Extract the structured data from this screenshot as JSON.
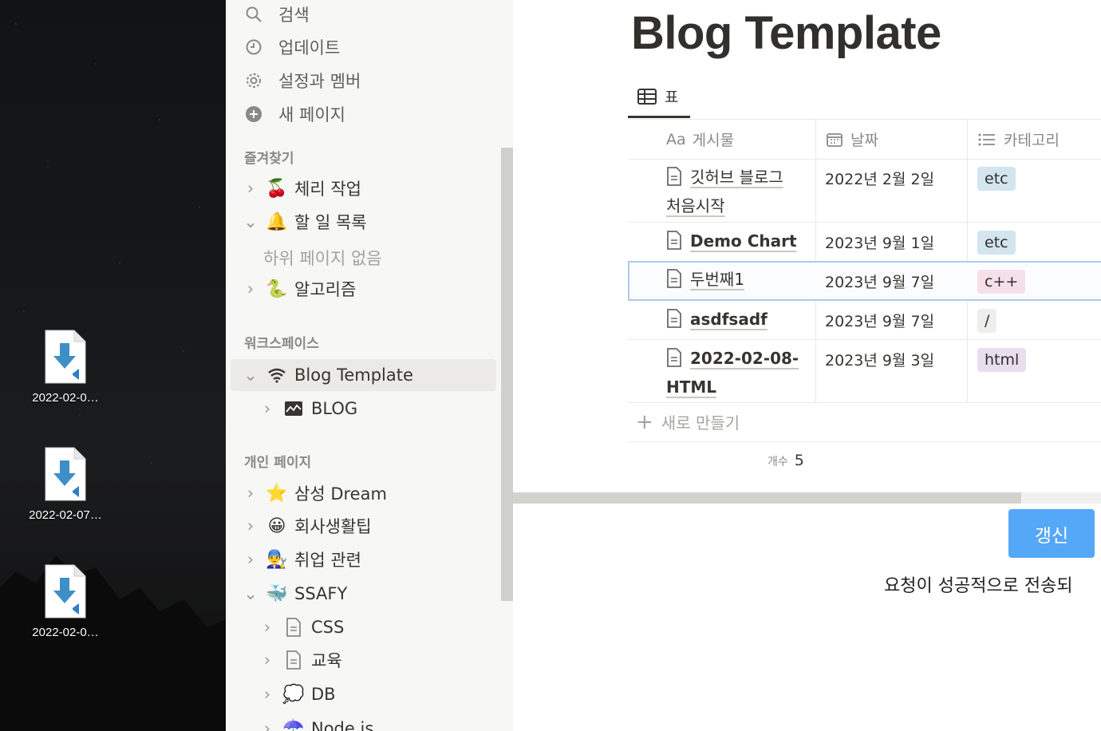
{
  "desktop": {
    "icons": [
      {
        "label": "2022-02-0…"
      },
      {
        "label": "2022-02-07…"
      },
      {
        "label": "2022-02-0…"
      }
    ]
  },
  "sidebar": {
    "nav": [
      {
        "label": "검색",
        "icon": "search-icon"
      },
      {
        "label": "업데이트",
        "icon": "clock-icon"
      },
      {
        "label": "설정과 멤버",
        "icon": "gear-icon"
      },
      {
        "label": "새 페이지",
        "icon": "plus-circle-icon"
      }
    ],
    "favorites_label": "즐겨찾기",
    "favorites": [
      {
        "label": "체리 작업",
        "emoji": "🍒"
      },
      {
        "label": "할 일 목록",
        "emoji": "🔔"
      },
      {
        "label": "알고리즘",
        "emoji": "🐍"
      }
    ],
    "no_subpages": "하위 페이지 없음",
    "workspace_label": "워크스페이스",
    "workspace": [
      {
        "label": "Blog Template"
      },
      {
        "label": "BLOG"
      }
    ],
    "personal_label": "개인 페이지",
    "personal": [
      {
        "label": "삼성 Dream",
        "emoji": "⭐"
      },
      {
        "label": "회사생활팁",
        "emoji": "😀"
      },
      {
        "label": "취업 관련",
        "emoji": "👨‍🔧"
      },
      {
        "label": "SSAFY",
        "emoji": "🐳"
      },
      {
        "label": "CSS"
      },
      {
        "label": "교육"
      },
      {
        "label": "DB",
        "emoji": "💭"
      },
      {
        "label": "Node.js",
        "emoji": "☂️"
      }
    ]
  },
  "main": {
    "title": "Blog Template",
    "view_tab": "표",
    "columns": [
      {
        "prefix": "Aa",
        "label": "게시물"
      },
      {
        "label": "날짜",
        "icon": "calendar-icon"
      },
      {
        "label": "카테고리",
        "icon": "list-icon"
      }
    ],
    "rows": [
      {
        "title_line1": "깃허브 블로그",
        "title_line2": "처음시작",
        "date": "2022년 2월 2일",
        "tag": "etc",
        "tag_color": "#d3e5ef"
      },
      {
        "title_line1": "Demo Chart",
        "title_line2": "",
        "date": "2023년 9월 1일",
        "tag": "etc",
        "tag_color": "#d3e5ef"
      },
      {
        "title_line1": "두번째1",
        "title_line2": "",
        "date": "2023년 9월 7일",
        "tag": "c++",
        "tag_color": "#f5e0e9"
      },
      {
        "title_line1": "asdfsadf",
        "title_line2": "",
        "date": "2023년 9월 7일",
        "tag": "/",
        "tag_color": "#eeeeed"
      },
      {
        "title_line1": "2022-02-08-",
        "title_line2": "HTML",
        "date": "2023년 9월 3일",
        "tag": "html",
        "tag_color": "#e8deee"
      }
    ],
    "new_row": "새로 만들기",
    "count_label": "개수",
    "count_value": "5",
    "update_button": "갱신",
    "status_message": "요청이 성공적으로 전송되"
  },
  "colors": {
    "accent_button": "#55a7f7",
    "sidebar_bg": "#f7f7f5",
    "selection_border": "#aecbee"
  }
}
